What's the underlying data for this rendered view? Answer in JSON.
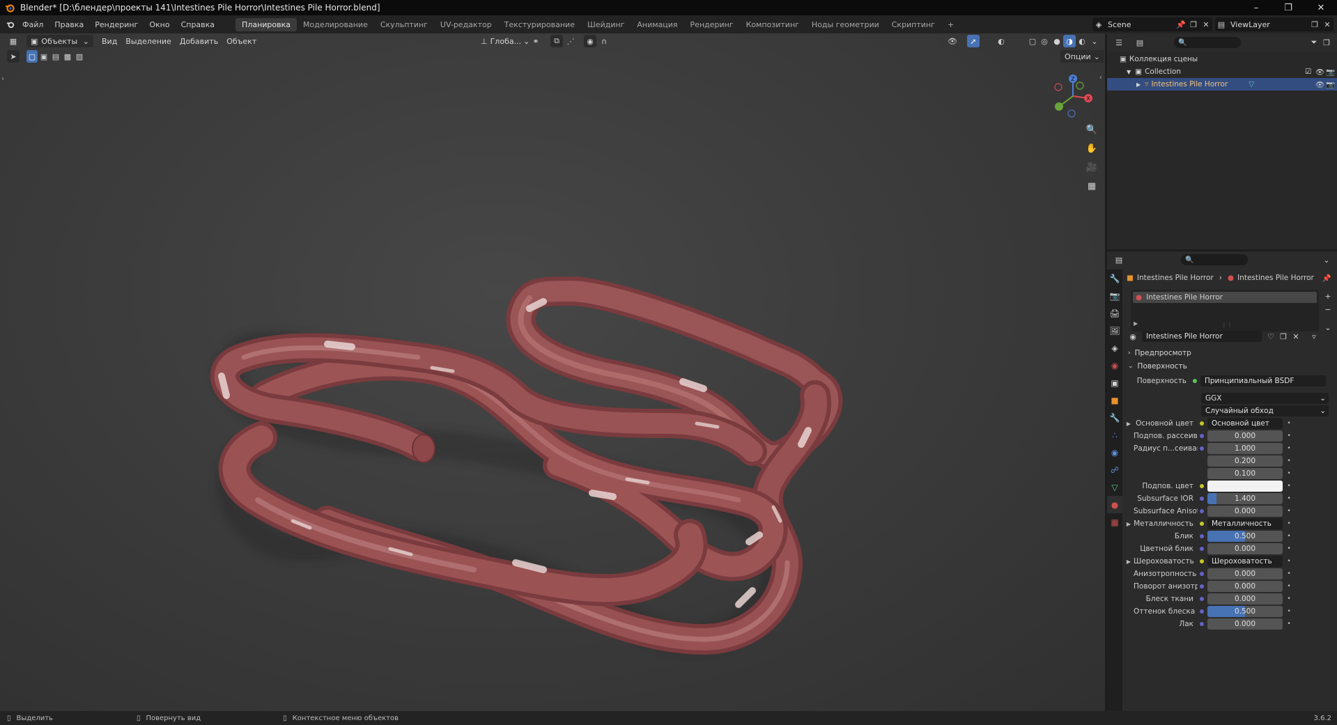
{
  "titlebar": {
    "title": "Blender* [D:\\блендер\\проекты 141\\Intestines Pile Horror\\Intestines Pile Horror.blend]"
  },
  "menu": [
    "Файл",
    "Правка",
    "Рендеринг",
    "Окно",
    "Справка"
  ],
  "workspaces": [
    "Планировка",
    "Моделирование",
    "Скульптинг",
    "UV-редактор",
    "Текстурирование",
    "Шейдинг",
    "Анимация",
    "Рендеринг",
    "Композитинг",
    "Ноды геометрии",
    "Скриптинг"
  ],
  "active_workspace": "Планировка",
  "scene": {
    "name": "Scene",
    "view_layer": "ViewLayer"
  },
  "viewport": {
    "mode": "Объекты",
    "menus": [
      "Вид",
      "Выделение",
      "Добавить",
      "Объект"
    ],
    "transform_orientation": "Глоба...",
    "options_label": "Опции",
    "gizmo": {
      "x": "X",
      "y": "Y",
      "z": "Z"
    }
  },
  "outliner": {
    "root": "Коллекция сцены",
    "collection": "Collection",
    "object": "Intestines Pile Horror"
  },
  "properties": {
    "breadcrumb_object": "Intestines Pile Horror",
    "breadcrumb_material": "Intestines Pile Horror",
    "slot": "Intestines Pile Horror",
    "material_name": "Intestines Pile Horror",
    "sections": {
      "preview": "Предпросмотр",
      "surface": "Поверхность"
    },
    "surface_label": "Поверхность",
    "surface_value": "Принципиальный BSDF",
    "distribution": "GGX",
    "subsurface_method": "Случайный обход",
    "rows": [
      {
        "label": "Основной цвет",
        "value": "Основной цвет",
        "type": "link",
        "expand": true
      },
      {
        "label": "Подпов. рассеива...",
        "value": "0.000",
        "type": "num",
        "fill": 0
      },
      {
        "label": "Радиус п...сеивания",
        "value": "1.000",
        "type": "num",
        "fill": 0
      },
      {
        "label": "",
        "value": "0.200",
        "type": "num",
        "fill": 0
      },
      {
        "label": "",
        "value": "0.100",
        "type": "num",
        "fill": 0
      },
      {
        "label": "Подпов. цвет",
        "value": "",
        "type": "color",
        "color": "#f2f2f2"
      },
      {
        "label": "Subsurface IOR",
        "value": "1.400",
        "type": "num",
        "fill": 0.12
      },
      {
        "label": "Subsurface Anisotr...",
        "value": "0.000",
        "type": "num",
        "fill": 0
      },
      {
        "label": "Металличность",
        "value": "Металличность",
        "type": "link",
        "expand": true
      },
      {
        "label": "Блик",
        "value": "0.500",
        "type": "num",
        "fill": 0.5
      },
      {
        "label": "Цветной блик",
        "value": "0.000",
        "type": "num",
        "fill": 0
      },
      {
        "label": "Шероховатость",
        "value": "Шероховатость",
        "type": "link",
        "expand": true
      },
      {
        "label": "Анизотропность",
        "value": "0.000",
        "type": "num",
        "fill": 0
      },
      {
        "label": "Поворот анизотро...",
        "value": "0.000",
        "type": "num",
        "fill": 0
      },
      {
        "label": "Блеск ткани",
        "value": "0.000",
        "type": "num",
        "fill": 0
      },
      {
        "label": "Оттенок блеска тк...",
        "value": "0.500",
        "type": "num",
        "fill": 0.5
      },
      {
        "label": "Лак",
        "value": "0.000",
        "type": "num",
        "fill": 0
      }
    ]
  },
  "statusbar": {
    "select": "Выделить",
    "rotate": "Повернуть вид",
    "context": "Контекстное меню объектов",
    "version": "3.6.2"
  },
  "colors": {
    "accent": "#4772b3",
    "selected_row": "#334d80",
    "flesh": "#8e4a4c",
    "fat": "#e4cccb"
  }
}
